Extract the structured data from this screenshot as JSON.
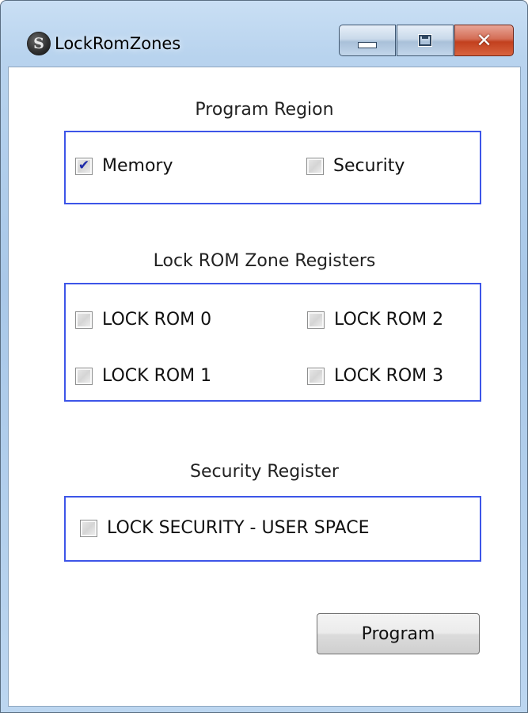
{
  "window": {
    "title": "LockRomZones",
    "app_icon_letter": "S",
    "controls": {
      "minimize": "minimize",
      "maximize": "maximize",
      "close": "✕"
    }
  },
  "program_region": {
    "heading": "Program Region",
    "options": [
      {
        "label": "Memory",
        "checked": true
      },
      {
        "label": "Security",
        "checked": false
      }
    ]
  },
  "lock_rom": {
    "heading": "Lock ROM Zone Registers",
    "options": [
      {
        "label": "LOCK ROM 0",
        "checked": false
      },
      {
        "label": "LOCK ROM 2",
        "checked": false
      },
      {
        "label": "LOCK ROM 1",
        "checked": false
      },
      {
        "label": "LOCK ROM 3",
        "checked": false
      }
    ]
  },
  "security_register": {
    "heading": "Security Register",
    "options": [
      {
        "label": "LOCK SECURITY - USER SPACE",
        "checked": false
      }
    ]
  },
  "actions": {
    "program_label": "Program"
  },
  "colors": {
    "group_border": "#3d55e8",
    "check_mark": "#1d2aa8"
  }
}
